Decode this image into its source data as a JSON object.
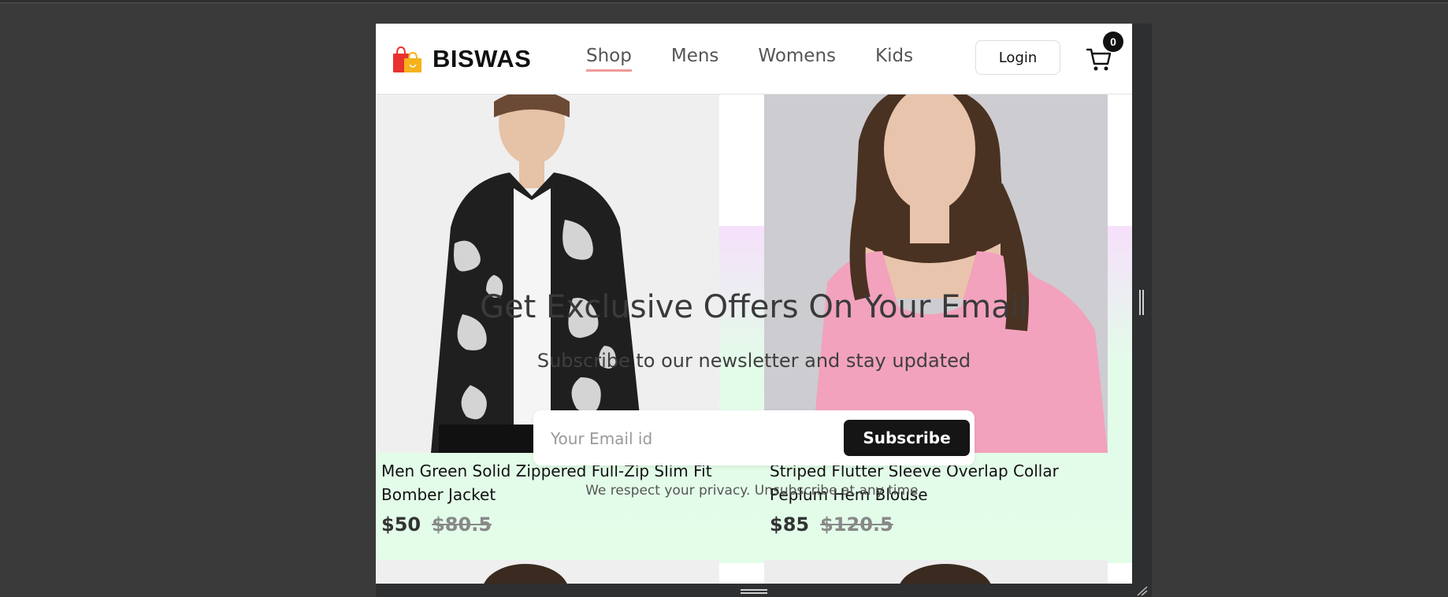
{
  "header": {
    "brand": "BISWAS",
    "nav": [
      {
        "label": "Shop",
        "active": true
      },
      {
        "label": "Mens",
        "active": false
      },
      {
        "label": "Womens",
        "active": false
      },
      {
        "label": "Kids",
        "active": false
      }
    ],
    "login_label": "Login",
    "cart_count": "0"
  },
  "products": [
    {
      "title": "Men Green Solid Zippered Full-Zip Slim Fit Bomber Jacket",
      "price": "$50",
      "old_price": "$80.5"
    },
    {
      "title": "Striped Flutter Sleeve Overlap Collar Peplum Hem Blouse",
      "price": "$85",
      "old_price": "$120.5"
    }
  ],
  "newsletter": {
    "title": "Get Exclusive Offers On Your Email",
    "subtitle": "Subscribe to our newsletter and stay updated",
    "email_placeholder": "Your Email id",
    "button_label": "Subscribe",
    "note": "We respect your privacy. Unsubscribe at any time."
  },
  "colors": {
    "accent_underline": "#f19a9a",
    "button_dark": "#151515",
    "band_top": "#f6e0fb",
    "band_bottom": "#e3fde9"
  }
}
